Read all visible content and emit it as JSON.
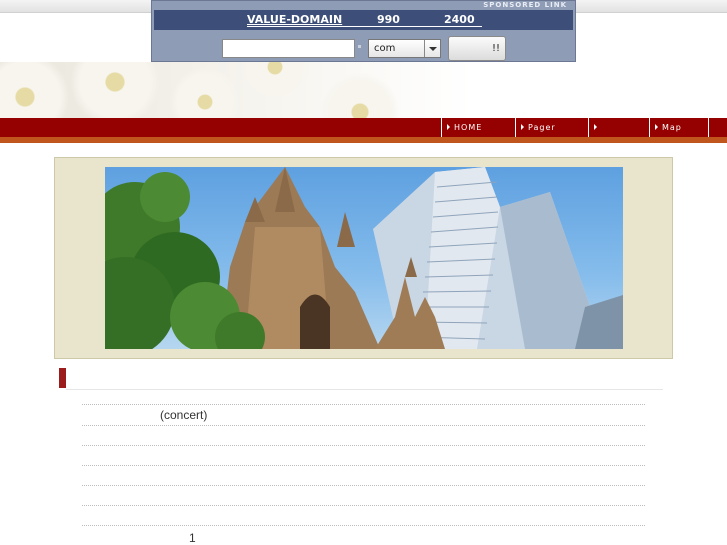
{
  "ad": {
    "sponsored_label": "SPONSORED LINK",
    "brand": "VALUE-DOMAIN",
    "price1": "990",
    "price2": "2400",
    "domain_input_value": "",
    "tld_selected": "com",
    "search_button_label": "!!"
  },
  "nav": {
    "items": [
      {
        "label": "HOME"
      },
      {
        "label": "Pager"
      },
      {
        "label": ""
      },
      {
        "label": "Map"
      }
    ]
  },
  "content": {
    "section_title": "",
    "rows": [
      {
        "text": ""
      },
      {
        "text": "(concert)"
      },
      {
        "text": ""
      },
      {
        "text": ""
      },
      {
        "text": ""
      },
      {
        "text": ""
      }
    ],
    "page_number": "1"
  },
  "colors": {
    "nav_bar": "#950000",
    "nav_accent": "#c0551d",
    "ad_banner": "#3d4f78",
    "hero_frame": "#e9e5cd",
    "title_marker": "#9c1c1c"
  }
}
